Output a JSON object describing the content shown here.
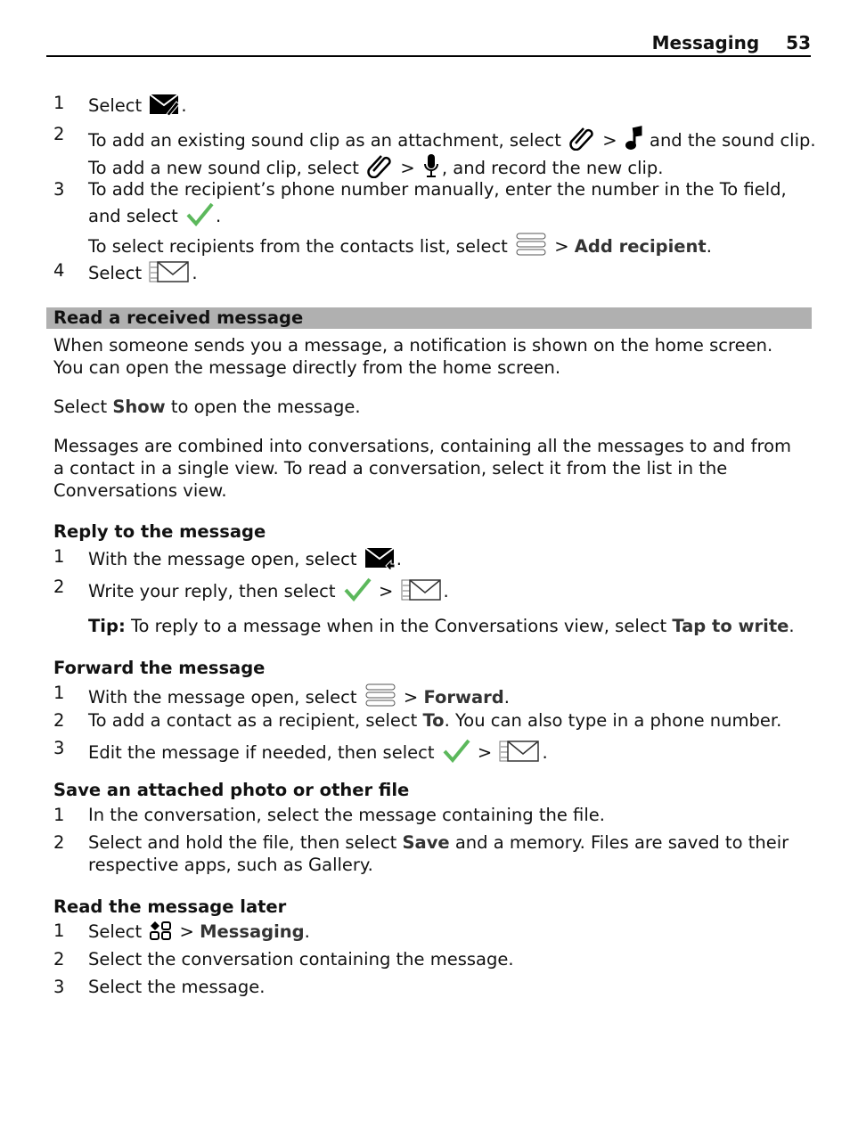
{
  "header": {
    "section": "Messaging",
    "page": "53"
  },
  "steps_top": [
    {
      "n": "1",
      "a": "Select ",
      "icon": "compose-message-icon",
      "b": "."
    },
    {
      "n": "2",
      "a": "To add an existing sound clip as an attachment, select ",
      "icon": "attachment-icon",
      "c": " > ",
      "icon2": "music-note-icon",
      "b": " and the sound clip."
    },
    {
      "a": "To add a new sound clip, select ",
      "icon": "attachment-icon",
      "c": " > ",
      "icon2": "microphone-icon",
      "b": ", and record the new clip."
    },
    {
      "n": "3",
      "a": "To add the recipient’s phone number manually, enter the number in the To field,"
    },
    {
      "a": "and select ",
      "icon": "checkmark-icon",
      "b": "."
    },
    {
      "a": "To select recipients from the contacts list, select ",
      "icon": "menu-icon",
      "c": " > ",
      "bold": "Add recipient",
      "b": "."
    },
    {
      "n": "4",
      "a": "Select ",
      "icon": "send-icon",
      "b": "."
    }
  ],
  "section_title": "Read a received message",
  "intro": [
    "When someone sends you a message, a notification is shown on the home screen.",
    "You can open the message directly from the home screen."
  ],
  "show_line": {
    "a": "Select ",
    "bold": "Show",
    "b": " to open the message."
  },
  "conv": [
    "Messages are combined into conversations, containing all the messages to and from",
    "a contact in a single view. To read a conversation, select it from the list in the",
    "Conversations view."
  ],
  "reply": {
    "title": "Reply to the message",
    "s1": {
      "n": "1",
      "a": "With the message open, select ",
      "b": "."
    },
    "s2": {
      "n": "2",
      "a": "Write your reply, then select ",
      "c": " > ",
      "b": "."
    },
    "tip": {
      "label": "Tip:",
      "a": " To reply to a message when in the Conversations view, select ",
      "bold": "Tap to write",
      "b": "."
    }
  },
  "forward": {
    "title": "Forward the message",
    "s1": {
      "n": "1",
      "a": "With the message open, select ",
      "c": " > ",
      "bold": "Forward",
      "b": "."
    },
    "s2": {
      "n": "2",
      "a": "To add a contact as a recipient, select ",
      "bold": "To",
      "b": ". You can also type in a phone number."
    },
    "s3": {
      "n": "3",
      "a": "Edit the message if needed, then select ",
      "c": " > ",
      "b": "."
    }
  },
  "save": {
    "title": "Save an attached photo or other file",
    "s1": {
      "n": "1",
      "a": "In the conversation, select the message containing the file."
    },
    "s2": {
      "n": "2",
      "a": "Select and hold the file, then select ",
      "bold": "Save",
      "b": " and a memory. Files are saved to their"
    },
    "s2b": "respective apps, such as Gallery."
  },
  "later": {
    "title": "Read the message later",
    "s1": {
      "n": "1",
      "a": "Select ",
      "c": " > ",
      "bold": "Messaging",
      "b": "."
    },
    "s2": {
      "n": "2",
      "a": "Select the conversation containing the message."
    },
    "s3": {
      "n": "3",
      "a": "Select the message."
    }
  },
  "colors": {
    "check": "#5cb85c",
    "section_bg": "#b0b0b0"
  }
}
